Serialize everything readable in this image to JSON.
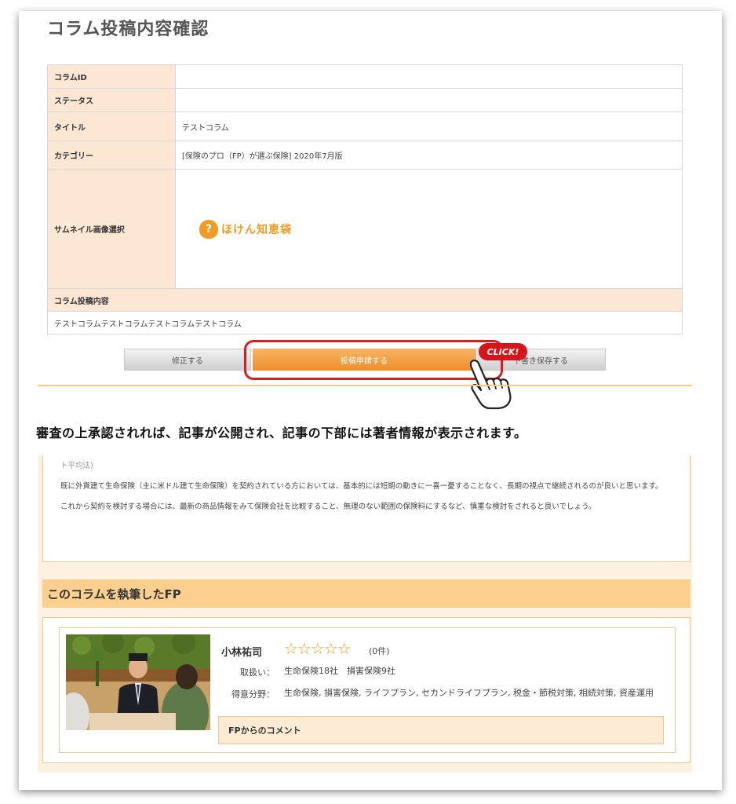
{
  "confirm": {
    "title": "コラム投稿内容確認",
    "rows": [
      {
        "label": "コラムID",
        "value": ""
      },
      {
        "label": "ステータス",
        "value": ""
      },
      {
        "label": "タイトル",
        "value": "テストコラム"
      },
      {
        "label": "カテゴリー",
        "value": "[保険のプロ（FP）が選ぶ保険] 2020年7月版"
      },
      {
        "label": "サムネイル画像選択",
        "value": ""
      }
    ],
    "thumbnail_logo_text": "ほけん知恵袋",
    "content_label": "コラム投稿内容",
    "content_value": "テストコラムテストコラムテストコラムテストコラム"
  },
  "buttons": {
    "edit": "修正する",
    "submit": "投稿申請する",
    "draft": "下書き保存する",
    "click_badge": "CLICK!"
  },
  "caption": "審査の上承認されれば、記事が公開され、記事の下部には著者情報が表示されます。",
  "article": {
    "clipped_line": "ト平均法)",
    "para1": "既に外貨建て生命保険（主に米ドル建て生命保険）を契約されている方においては、基本的には短期の動きに一喜一憂することなく、長期の視点で継続されるのが良いと思います。",
    "para2": "これから契約を検討する場合には、最新の商品情報をみて保険会社を比較すること、無理のない範囲の保険料にするなど、慎重な検討をされると良いでしょう。"
  },
  "fp": {
    "heading": "このコラムを執筆したFP",
    "name": "小林祐司",
    "stars": "☆☆☆☆☆",
    "rating_count": "(0件)",
    "handles_label": "取扱い：",
    "handles_value": "生命保険18社　損害保険9社",
    "specialty_label": "得意分野：",
    "specialty_value": "生命保険, 損害保険, ライフプラン, セカンドライフプラン, 税金・節税対策, 相続対策, 資産運用",
    "comment_label": "FPからのコメント"
  },
  "colors": {
    "accent_orange": "#ee8e2c",
    "label_bg": "#fbe7d3",
    "highlight_red": "#e11b1b"
  }
}
